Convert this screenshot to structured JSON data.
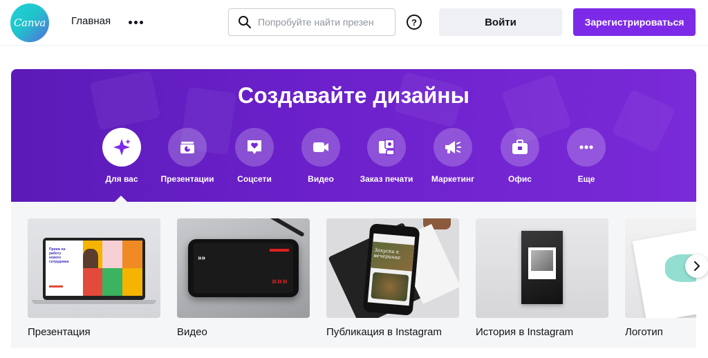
{
  "header": {
    "logo_text": "Canva",
    "nav_home": "Главная",
    "search_placeholder": "Попробуйте найти презен",
    "help_label": "?",
    "login_label": "Войти",
    "signup_label": "Зарегистрироваться"
  },
  "hero": {
    "title": "Создавайте дизайны",
    "categories": [
      {
        "label": "Для вас",
        "icon": "sparkle-icon",
        "active": true
      },
      {
        "label": "Презентации",
        "icon": "presentation-icon"
      },
      {
        "label": "Соцсети",
        "icon": "heart-chat-icon"
      },
      {
        "label": "Видео",
        "icon": "video-camera-icon"
      },
      {
        "label": "Заказ печати",
        "icon": "print-icon"
      },
      {
        "label": "Маркетинг",
        "icon": "megaphone-icon"
      },
      {
        "label": "Офис",
        "icon": "briefcase-icon"
      },
      {
        "label": "Еще",
        "icon": "more-icon"
      }
    ]
  },
  "templates": [
    {
      "title": "Презентация"
    },
    {
      "title": "Видео"
    },
    {
      "title": "Публикация в Instagram"
    },
    {
      "title": "История в Instagram"
    },
    {
      "title": "Логотип"
    }
  ],
  "thumb_text": {
    "presentation_line1": "Прием на",
    "presentation_line2": "работу",
    "presentation_line3": "нового",
    "presentation_line4": "сотрудника",
    "instagram_post": "Закуски к вечеринке"
  },
  "colors": {
    "brand_purple": "#7d2ae8",
    "logo_teal": "#20c4cb",
    "hero_purple": "#6a20c9"
  }
}
